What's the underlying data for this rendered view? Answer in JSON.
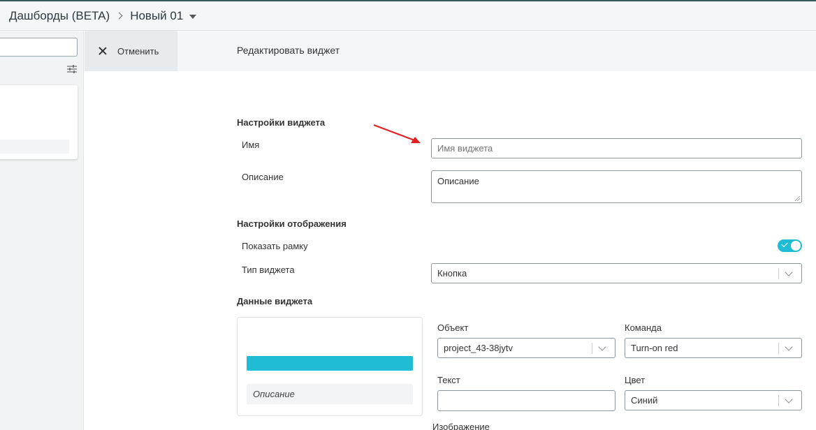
{
  "breadcrumb": {
    "parent": "Дашборды (BETA)",
    "current": "Новый 01"
  },
  "header": {
    "cancel_label": "Отменить",
    "title": "Редактировать виджет"
  },
  "widget_settings": {
    "title": "Настройки виджета",
    "name_label": "Имя",
    "name_placeholder": "Имя виджета",
    "description_label": "Описание",
    "description_placeholder": "Описание"
  },
  "display_settings": {
    "title": "Настройки отображения",
    "show_frame_label": "Показать рамку",
    "show_frame_on": true,
    "widget_type_label": "Тип виджета",
    "widget_type_value": "Кнопка"
  },
  "widget_data": {
    "title": "Данные виджета",
    "preview_description": "Описание",
    "object_label": "Объект",
    "object_value": "project_43-38jytv",
    "command_label": "Команда",
    "command_value": "Turn-on red",
    "text_label": "Текст",
    "text_value": "",
    "color_label": "Цвет",
    "color_value": "Синий",
    "image_label": "Изображение"
  },
  "colors": {
    "accent": "#20bcd4",
    "topbar_border": "#2f5d57",
    "annotation_arrow": "#e02020"
  }
}
